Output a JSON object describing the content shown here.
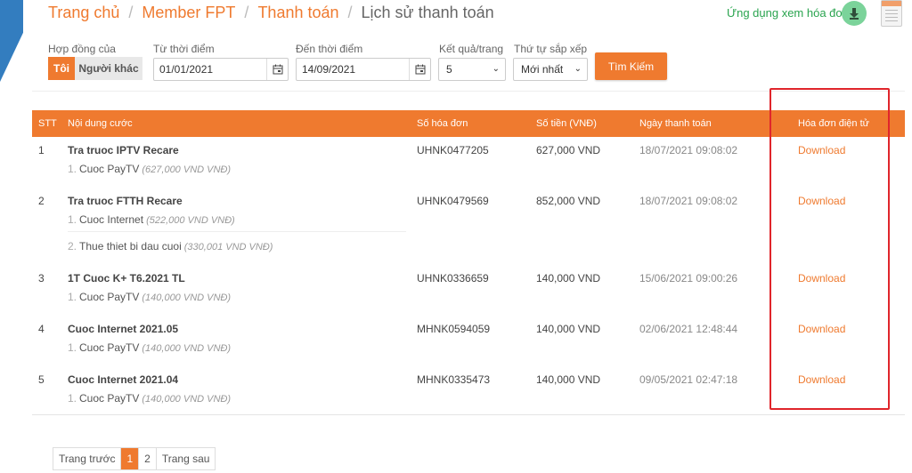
{
  "breadcrumb": [
    "Trang chủ",
    "Member FPT",
    "Thanh toán",
    "Lịch sử thanh toán"
  ],
  "header": {
    "app_link": "Ứng dụng xem hóa đơn"
  },
  "filters": {
    "contract_label": "Hợp đồng của",
    "contract_options": [
      "Tôi",
      "Người khác"
    ],
    "from_label": "Từ thời điểm",
    "from_value": "01/01/2021",
    "to_label": "Đến thời điểm",
    "to_value": "14/09/2021",
    "per_page_label": "Kết quả/trang",
    "per_page_value": "5",
    "sort_label": "Thứ tự sắp xếp",
    "sort_value": "Mới nhất",
    "search_label": "Tìm Kiếm"
  },
  "table": {
    "headers": [
      "STT",
      "Nội dung cước",
      "Số hóa đơn",
      "Số tiền (VNĐ)",
      "Ngày thanh toán",
      "Hóa đơn điện tử"
    ],
    "rows": [
      {
        "stt": "1",
        "title": "Tra truoc IPTV Recare",
        "items": [
          {
            "n": "1.",
            "name": "Cuoc PayTV",
            "amt": "(627,000 VND VNĐ)"
          }
        ],
        "invoice": "UHNK0477205",
        "amount": "627,000 VND",
        "date": "18/07/2021 09:08:02",
        "link": "Download"
      },
      {
        "stt": "2",
        "title": "Tra truoc FTTH Recare",
        "items": [
          {
            "n": "1.",
            "name": "Cuoc Internet",
            "amt": "(522,000 VND VNĐ)"
          },
          {
            "n": "2.",
            "name": "Thue thiet bi dau cuoi",
            "amt": "(330,001 VND VNĐ)"
          }
        ],
        "invoice": "UHNK0479569",
        "amount": "852,000 VND",
        "date": "18/07/2021 09:08:02",
        "link": "Download"
      },
      {
        "stt": "3",
        "title": "1T Cuoc K+ T6.2021 TL",
        "items": [
          {
            "n": "1.",
            "name": "Cuoc PayTV",
            "amt": "(140,000 VND VNĐ)"
          }
        ],
        "invoice": "UHNK0336659",
        "amount": "140,000 VND",
        "date": "15/06/2021 09:00:26",
        "link": "Download"
      },
      {
        "stt": "4",
        "title": "Cuoc Internet 2021.05",
        "items": [
          {
            "n": "1.",
            "name": "Cuoc PayTV",
            "amt": "(140,000 VND VNĐ)"
          }
        ],
        "invoice": "MHNK0594059",
        "amount": "140,000 VND",
        "date": "02/06/2021 12:48:44",
        "link": "Download"
      },
      {
        "stt": "5",
        "title": "Cuoc Internet 2021.04",
        "items": [
          {
            "n": "1.",
            "name": "Cuoc PayTV",
            "amt": "(140,000 VND VNĐ)"
          }
        ],
        "invoice": "MHNK0335473",
        "amount": "140,000 VND",
        "date": "09/05/2021 02:47:18",
        "link": "Download"
      }
    ]
  },
  "pager": {
    "prev": "Trang trước",
    "pages": [
      "1",
      "2"
    ],
    "next": "Trang sau"
  },
  "colors": {
    "accent": "#ef7a2f",
    "highlight": "#e0252b",
    "app_link": "#2aa44f"
  }
}
